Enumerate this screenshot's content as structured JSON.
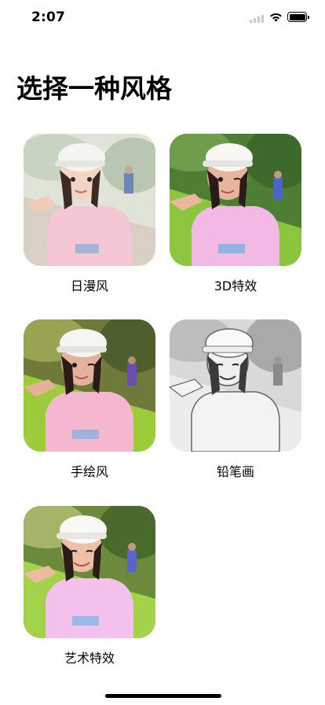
{
  "status_bar": {
    "time": "2:07"
  },
  "title": "选择一种风格",
  "styles": [
    {
      "label": "日漫风"
    },
    {
      "label": "3D特效"
    },
    {
      "label": "手绘风"
    },
    {
      "label": "铅笔画"
    },
    {
      "label": "艺术特效"
    }
  ]
}
